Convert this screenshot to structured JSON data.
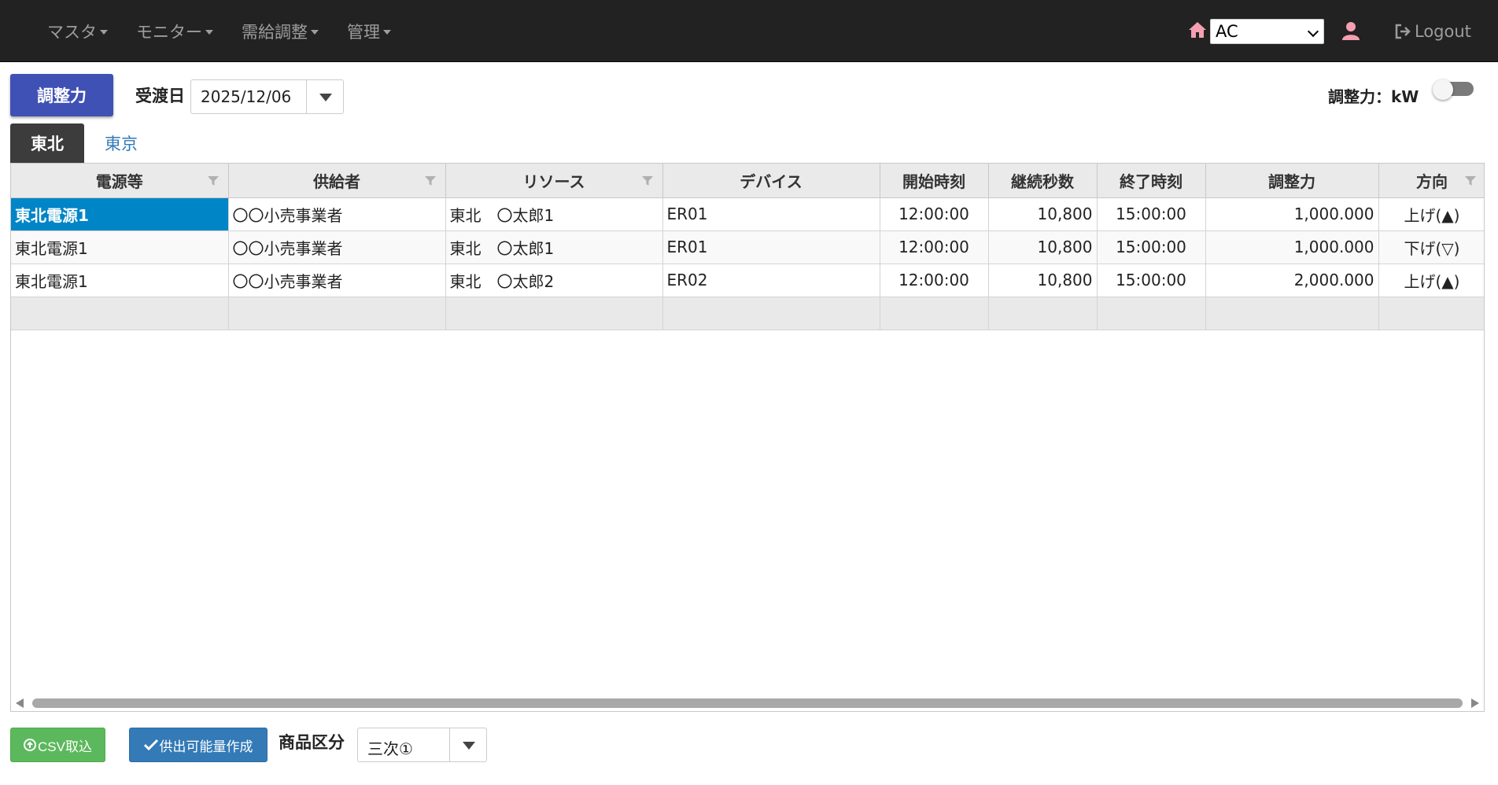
{
  "navbar": {
    "menu": [
      {
        "label": "マスタ"
      },
      {
        "label": "モニター"
      },
      {
        "label": "需給調整"
      },
      {
        "label": "管理"
      }
    ],
    "org_select_value": "AC",
    "logout_label": "Logout",
    "colors": {
      "background": "#222222",
      "text": "#9d9d9d",
      "home_icon": "#f4a0b0",
      "user_icon": "#f4a0b0"
    }
  },
  "toolbar": {
    "adjust_button_label": "調整力",
    "date_label": "受渡日",
    "date_value": "2025/12/06",
    "unit_label": "調整力：kW",
    "unit_toggle_on": false,
    "colors": {
      "adjust_button": "#3f51b5"
    }
  },
  "tabs": [
    {
      "label": "東北",
      "active": true
    },
    {
      "label": "東京",
      "active": false
    }
  ],
  "grid": {
    "columns": [
      {
        "label": "電源等",
        "filter": true
      },
      {
        "label": "供給者",
        "filter": true
      },
      {
        "label": "リソース",
        "filter": true
      },
      {
        "label": "デバイス",
        "filter": false
      },
      {
        "label": "開始時刻",
        "filter": false
      },
      {
        "label": "継続秒数",
        "filter": false
      },
      {
        "label": "終了時刻",
        "filter": false
      },
      {
        "label": "調整力",
        "filter": false
      },
      {
        "label": "方向",
        "filter": true
      }
    ],
    "rows": [
      {
        "source": "東北電源1",
        "supplier": "〇〇小売事業者",
        "resource": "東北　〇太郎1",
        "device": "ER01",
        "start": "12:00:00",
        "duration": "10,800",
        "end": "15:00:00",
        "capacity": "1,000.000",
        "direction": "上げ(▲)"
      },
      {
        "source": "東北電源1",
        "supplier": "〇〇小売事業者",
        "resource": "東北　〇太郎1",
        "device": "ER01",
        "start": "12:00:00",
        "duration": "10,800",
        "end": "15:00:00",
        "capacity": "1,000.000",
        "direction": "下げ(▽)"
      },
      {
        "source": "東北電源1",
        "supplier": "〇〇小売事業者",
        "resource": "東北　〇太郎2",
        "device": "ER02",
        "start": "12:00:00",
        "duration": "10,800",
        "end": "15:00:00",
        "capacity": "2,000.000",
        "direction": "上げ(▲)"
      }
    ],
    "selected_row": 0,
    "colors": {
      "header_bg": "#eaeaea",
      "selected_cell": "#0085c7"
    }
  },
  "footer": {
    "csv_button_label": "CSV取込",
    "create_button_label": "供出可能量作成",
    "product_label": "商品区分",
    "product_value": "三次①",
    "colors": {
      "csv_button": "#5cb85c",
      "create_button": "#337ab7"
    }
  }
}
